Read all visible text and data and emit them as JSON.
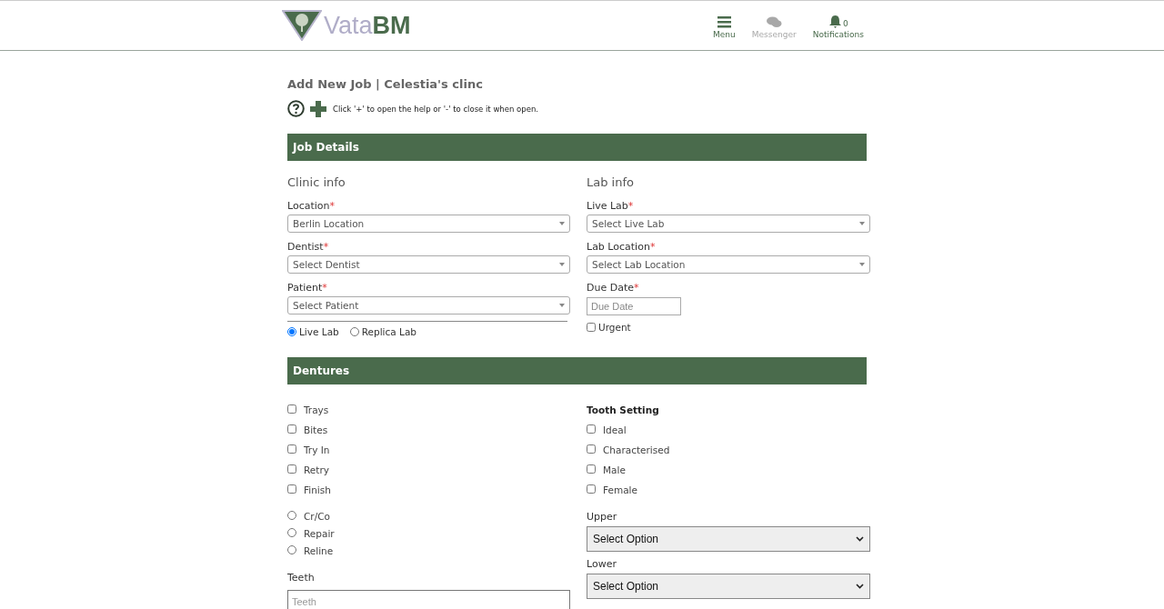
{
  "header": {
    "brand": {
      "light": "Vata",
      "bold": "BM"
    },
    "nav": [
      {
        "kind": "menu",
        "label": "Menu",
        "disabled": false
      },
      {
        "kind": "messenger",
        "label": "Messenger",
        "disabled": true
      },
      {
        "kind": "notifications",
        "label": "Notifications",
        "disabled": false,
        "count": "0"
      }
    ]
  },
  "page_title": "Add New Job | Celestia's clinc",
  "help": {
    "text": "Click '+' to open the help or '-' to close it when open."
  },
  "job_details": {
    "title": "Job Details",
    "clinic": {
      "heading": "Clinic info",
      "fields": [
        {
          "label": "Location",
          "mark": "*",
          "value": "Berlin Location"
        },
        {
          "label": "Dentist",
          "mark": "*",
          "value": "Select Dentist"
        },
        {
          "label": "Patient",
          "mark": "*",
          "value": "Select Patient"
        }
      ],
      "lab_type": [
        {
          "label": "Live Lab",
          "selected": true
        },
        {
          "label": "Replica Lab",
          "selected": false
        }
      ]
    },
    "lab": {
      "heading": "Lab info",
      "fields": [
        {
          "label": "Live Lab",
          "mark": "*",
          "value": "Select Live Lab"
        },
        {
          "label": "Lab Location",
          "mark": "*",
          "value": "Select Lab Location"
        }
      ],
      "due_date": {
        "label": "Due Date",
        "mark": "*",
        "placeholder": "Due Date"
      },
      "urgent": {
        "label": "Urgent",
        "checked": false
      }
    }
  },
  "dentures": {
    "title": "Dentures",
    "stages": [
      {
        "label": "Trays",
        "checked": false
      },
      {
        "label": "Bites",
        "checked": false
      },
      {
        "label": "Try In",
        "checked": false
      },
      {
        "label": "Retry",
        "checked": false
      },
      {
        "label": "Finish",
        "checked": false
      }
    ],
    "work": [
      {
        "label": "Cr/Co",
        "selected": false
      },
      {
        "label": "Repair",
        "selected": false
      },
      {
        "label": "Reline",
        "selected": false
      }
    ],
    "teeth": {
      "label": "Teeth",
      "placeholder": "Teeth"
    },
    "tooth_setting": {
      "heading": "Tooth Setting",
      "options": [
        {
          "label": "Ideal",
          "checked": false
        },
        {
          "label": "Characterised",
          "checked": false
        },
        {
          "label": "Male",
          "checked": false
        },
        {
          "label": "Female",
          "checked": false
        }
      ]
    },
    "selects": [
      {
        "label": "Upper",
        "value": "Select Option"
      },
      {
        "label": "Lower",
        "value": "Select Option"
      }
    ]
  }
}
